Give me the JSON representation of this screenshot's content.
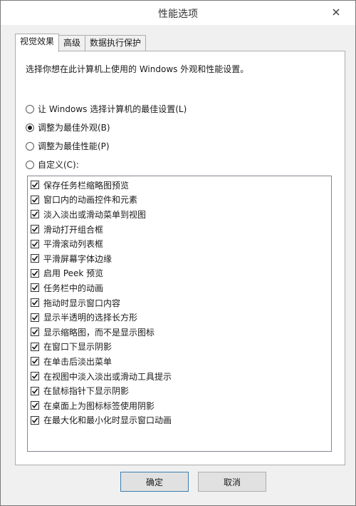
{
  "window": {
    "title": "性能选项"
  },
  "tabs": [
    {
      "label": "视觉效果",
      "active": true
    },
    {
      "label": "高级",
      "active": false
    },
    {
      "label": "数据执行保护",
      "active": false
    }
  ],
  "panel": {
    "description": "选择你想在此计算机上使用的 Windows 外观和性能设置。",
    "radios": [
      {
        "label": "让 Windows 选择计算机的最佳设置(L)",
        "checked": false
      },
      {
        "label": "调整为最佳外观(B)",
        "checked": true
      },
      {
        "label": "调整为最佳性能(P)",
        "checked": false
      },
      {
        "label": "自定义(C):",
        "checked": false
      }
    ],
    "options": [
      {
        "label": "保存任务栏缩略图预览",
        "checked": true
      },
      {
        "label": "窗口内的动画控件和元素",
        "checked": true
      },
      {
        "label": "淡入淡出或滑动菜单到视图",
        "checked": true
      },
      {
        "label": "滑动打开组合框",
        "checked": true
      },
      {
        "label": "平滑滚动列表框",
        "checked": true
      },
      {
        "label": "平滑屏幕字体边缘",
        "checked": true
      },
      {
        "label": "启用 Peek 预览",
        "checked": true
      },
      {
        "label": "任务栏中的动画",
        "checked": true
      },
      {
        "label": "拖动时显示窗口内容",
        "checked": true
      },
      {
        "label": "显示半透明的选择长方形",
        "checked": true
      },
      {
        "label": "显示缩略图，而不是显示图标",
        "checked": true
      },
      {
        "label": "在窗口下显示阴影",
        "checked": true
      },
      {
        "label": "在单击后淡出菜单",
        "checked": true
      },
      {
        "label": "在视图中淡入淡出或滑动工具提示",
        "checked": true
      },
      {
        "label": "在鼠标指针下显示阴影",
        "checked": true
      },
      {
        "label": "在桌面上为图标标签使用阴影",
        "checked": true
      },
      {
        "label": "在最大化和最小化时显示窗口动画",
        "checked": true
      }
    ]
  },
  "buttons": {
    "ok": "确定",
    "cancel": "取消"
  }
}
